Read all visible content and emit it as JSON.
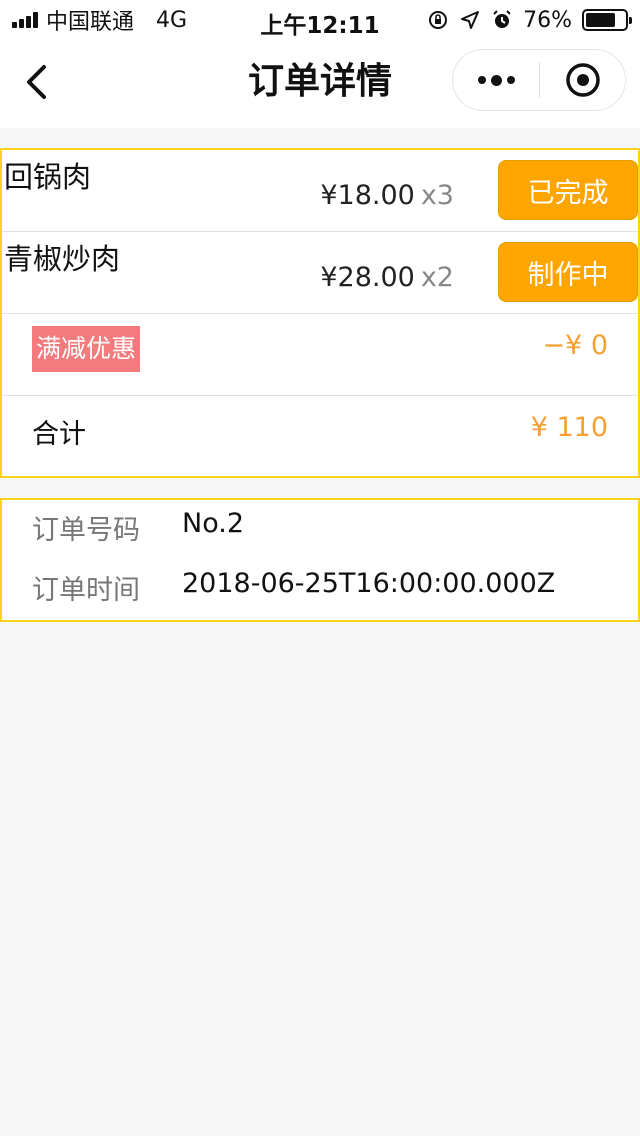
{
  "status_bar": {
    "carrier": "中国联通",
    "network": "4G",
    "time": "上午12:11",
    "battery_percent": "76%",
    "battery_level": 0.76,
    "signal_bars": 4
  },
  "nav": {
    "title": "订单详情"
  },
  "order": {
    "items": [
      {
        "name": "回锅肉",
        "price": "¥18.00",
        "qty": "x3",
        "status": "已完成"
      },
      {
        "name": "青椒炒肉",
        "price": "¥28.00",
        "qty": "x2",
        "status": "制作中"
      }
    ],
    "discount_label": "满减优惠",
    "discount_amount": "−¥ 0",
    "total_label": "合计",
    "total_amount": "¥ 110"
  },
  "info": {
    "number_label": "订单号码",
    "number_value": "No.2",
    "time_label": "订单时间",
    "time_value": "2018-06-25T16:00:00.000Z"
  },
  "colors": {
    "accent": "#ffa500",
    "border": "#ffd21e",
    "discount_badge": "#f37b7d",
    "price_highlight": "#f5a030"
  }
}
